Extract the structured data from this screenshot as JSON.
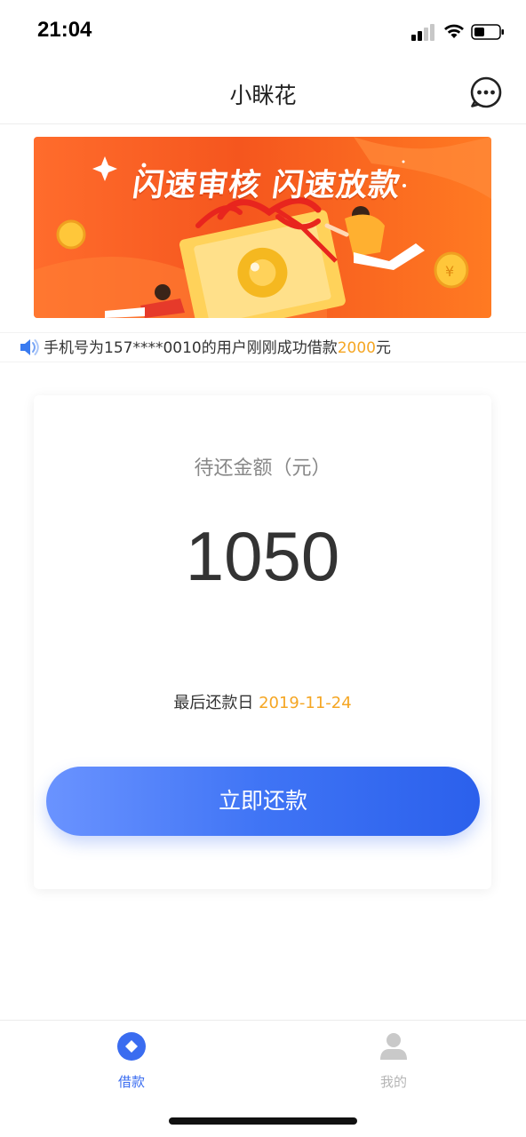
{
  "status_bar": {
    "time": "21:04"
  },
  "header": {
    "title": "小眯花",
    "more_icon": "more-dots-icon"
  },
  "banner": {
    "headline": "闪速审核 闪速放款"
  },
  "notice": {
    "icon": "speaker-icon",
    "prefix": "手机号为157****0010的用户刚刚成功借款",
    "amount": "2000",
    "suffix": "元"
  },
  "card": {
    "label": "待还金额（元）",
    "amount": "1050",
    "due_label": "最后还款日",
    "due_date": "2019-11-24",
    "button_label": "立即还款"
  },
  "tab_bar": {
    "items": [
      {
        "label": "借款",
        "icon": "loan-diamond-icon",
        "active": true
      },
      {
        "label": "我的",
        "icon": "person-icon",
        "active": false
      }
    ]
  },
  "colors": {
    "accent_blue": "#3a6cf0",
    "highlight_orange": "#f5a623",
    "banner_orange": "#f5561e"
  }
}
